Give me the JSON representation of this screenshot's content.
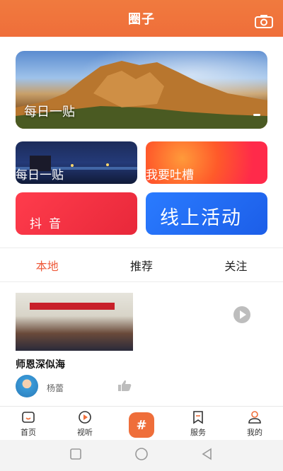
{
  "header": {
    "title": "圈子",
    "camera_icon": "camera-icon"
  },
  "hero": {
    "label": "每日一贴"
  },
  "cards": [
    {
      "label": "每日一贴"
    },
    {
      "label": "我要吐槽"
    },
    {
      "label": "抖音"
    },
    {
      "label": "线上活动"
    }
  ],
  "tabs": [
    {
      "label": "本地",
      "active": true
    },
    {
      "label": "推荐",
      "active": false
    },
    {
      "label": "关注",
      "active": false
    }
  ],
  "post": {
    "title": "师恩深似海",
    "author": "杨蕾"
  },
  "bottom_nav": [
    {
      "label": "首页",
      "icon": "home-icon"
    },
    {
      "label": "视听",
      "icon": "play-circle-icon"
    },
    {
      "label": "#",
      "icon": "hashtag-icon"
    },
    {
      "label": "服务",
      "icon": "bookmark-icon"
    },
    {
      "label": "我的",
      "icon": "user-icon"
    }
  ],
  "colors": {
    "accent": "#ef6e3a",
    "tab_active": "#ee5a3a"
  }
}
